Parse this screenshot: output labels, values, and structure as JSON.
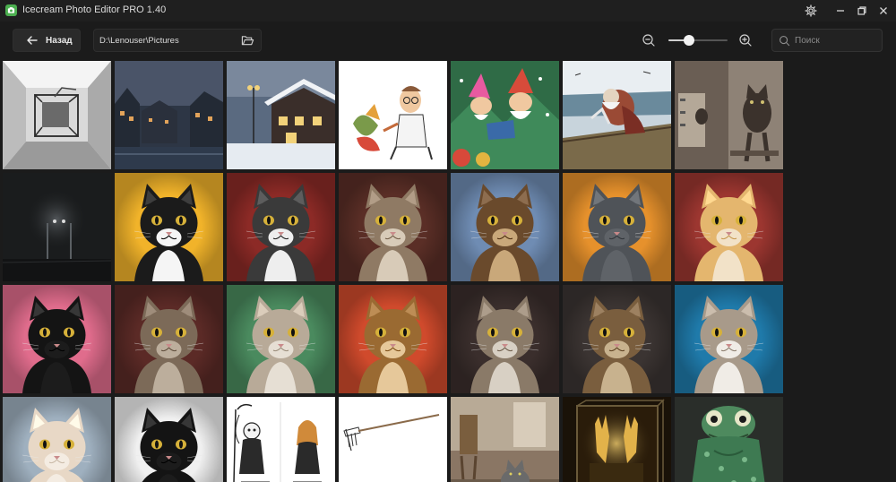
{
  "window": {
    "title": "Icecream Photo Editor PRO 1.40",
    "accent": "#4caf50"
  },
  "toolbar": {
    "back_label": "Назад",
    "path_value": "D:\\Lenouser\\Pictures",
    "zoom_level": 0.35,
    "search_placeholder": "Поиск"
  },
  "grid": {
    "rows": [
      [
        {
          "kind": "mono-interior",
          "bg": "#d9d9d9",
          "fg": "#6a6a6a"
        },
        {
          "kind": "night-town",
          "bg": "#2d3645",
          "fg": "#e2a35a"
        },
        {
          "kind": "snow-street",
          "bg": "#5a6a80",
          "fg": "#f2d27a"
        },
        {
          "kind": "cartoon-art",
          "bg": "#ffffff",
          "fg": "#c46a3a"
        },
        {
          "kind": "gnome-painting",
          "bg": "#2f6b46",
          "fg": "#d84b3a"
        },
        {
          "kind": "winter-boat",
          "bg": "#c8d4dc",
          "fg": "#9a4a35"
        },
        {
          "kind": "sepia-cats",
          "bg": "#8e8276",
          "fg": "#3b322c"
        }
      ],
      [
        {
          "kind": "dark-foggy",
          "bg": "#1a1c1d",
          "fg": "#5a5f63"
        },
        {
          "kind": "cat",
          "bg": "#f1b32a",
          "fg": "#1b1b1b",
          "chest": "#f5f5f5"
        },
        {
          "kind": "cat",
          "bg": "#8c2a26",
          "fg": "#3a3a3a",
          "chest": "#eeeeee"
        },
        {
          "kind": "cat",
          "bg": "#5a2e26",
          "fg": "#8f7a64",
          "chest": "#d8cbb8"
        },
        {
          "kind": "cat",
          "bg": "#6f8cb3",
          "fg": "#6a4a2c",
          "chest": "#c9a87a"
        },
        {
          "kind": "cat",
          "bg": "#e6912c",
          "fg": "#4f5358",
          "chest": "#5f6368"
        },
        {
          "kind": "cat",
          "bg": "#9c3630",
          "fg": "#e4b66e",
          "chest": "#f2e2c8"
        }
      ],
      [
        {
          "kind": "cat",
          "bg": "#e06c8c",
          "fg": "#141414",
          "chest": "#1c1c1c"
        },
        {
          "kind": "cat",
          "bg": "#5b2a26",
          "fg": "#7c6a58",
          "chest": "#bcae9c"
        },
        {
          "kind": "cat",
          "bg": "#4a8a5e",
          "fg": "#b8aa98",
          "chest": "#e6dfd4"
        },
        {
          "kind": "cat",
          "bg": "#d04a2c",
          "fg": "#9a6a32",
          "chest": "#e6c89a"
        },
        {
          "kind": "cat",
          "bg": "#3a2e2c",
          "fg": "#8a7a68",
          "chest": "#d8d0c4"
        },
        {
          "kind": "cat",
          "bg": "#3b3432",
          "fg": "#7a5e3e",
          "chest": "#c8b28e"
        },
        {
          "kind": "cat",
          "bg": "#1f7aaa",
          "fg": "#a89a8a",
          "chest": "#f0ece6"
        }
      ],
      [
        {
          "kind": "cat",
          "bg": "#9fb0bf",
          "fg": "#e8d8c6",
          "chest": "#f4ece2"
        },
        {
          "kind": "cat",
          "bg": "#f0f0f0",
          "fg": "#141414",
          "chest": "#1c1c1c"
        },
        {
          "kind": "comic",
          "bg": "#ffffff",
          "fg": "#222222"
        },
        {
          "kind": "rake",
          "bg": "#ffffff",
          "fg": "#333333"
        },
        {
          "kind": "room-cat",
          "bg": "#8a7664",
          "fg": "#6a6a6a"
        },
        {
          "kind": "gold-hands",
          "bg": "#1a1208",
          "fg": "#e2b24a"
        },
        {
          "kind": "frog",
          "bg": "#2a2e2a",
          "fg": "#4e8a5e"
        }
      ]
    ]
  }
}
